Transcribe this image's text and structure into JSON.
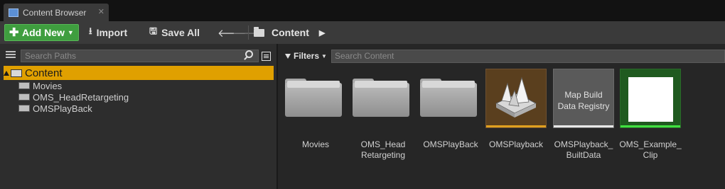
{
  "tab": {
    "title": "Content Browser",
    "icon": "content-browser-icon",
    "close": "✕"
  },
  "toolbar": {
    "add_new": "Add New",
    "import": "Import",
    "save_all": "Save All",
    "back_arrow": "🡐",
    "forward_arrow": "🡒",
    "breadcrumb": "Content",
    "breadcrumb_arrow": "▶"
  },
  "left": {
    "search_placeholder": "Search Paths",
    "tree": {
      "root": "Content",
      "items": [
        "Movies",
        "OMS_HeadRetargeting",
        "OMSPlayBack"
      ]
    }
  },
  "right": {
    "filters_label": "Filters",
    "search_placeholder": "Search Content",
    "assets": [
      {
        "label": "Movies",
        "kind": "folder"
      },
      {
        "label": "OMS_Head\nRetargeting",
        "kind": "folder"
      },
      {
        "label": "OMSPlayBack",
        "kind": "folder"
      },
      {
        "label": "OMSPlayback",
        "kind": "asset",
        "bar_color": "#e0a020"
      },
      {
        "label": "OMSPlayback_\nBuiltData",
        "kind": "asset",
        "thumb_text": "Map Build\nData Registry",
        "bar_color": "#e8e8e8"
      },
      {
        "label": "OMS_Example_\nClip",
        "kind": "asset",
        "bar_color": "#40e040"
      }
    ]
  },
  "colors": {
    "accent_selected": "#e0a000",
    "add_new_green": "#3f9e3f"
  }
}
